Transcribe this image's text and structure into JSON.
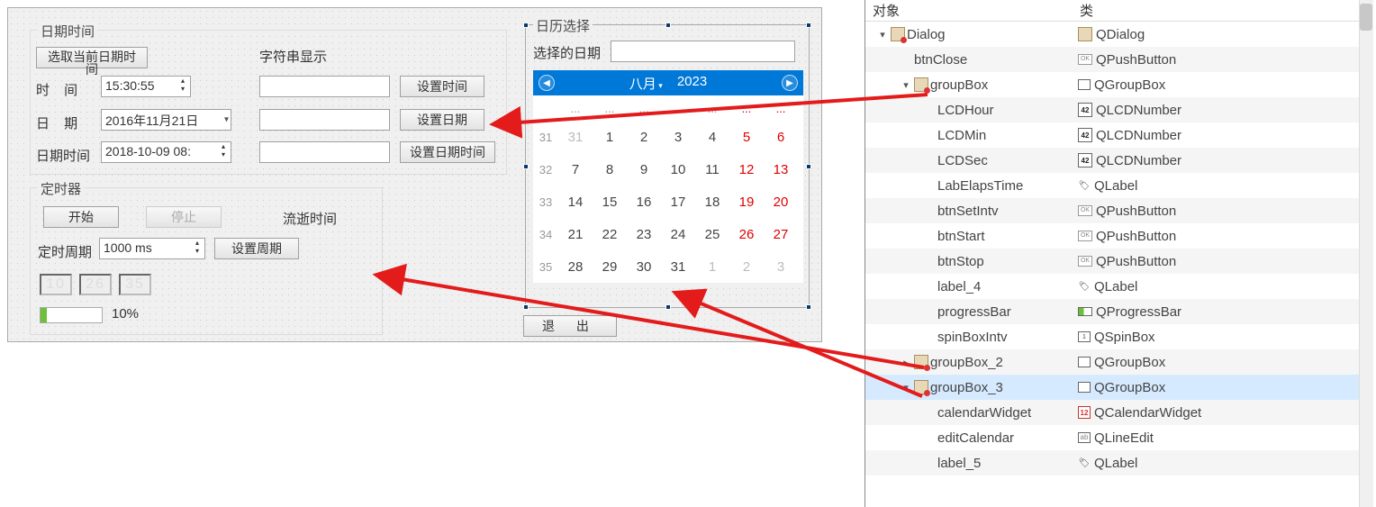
{
  "gb_datetime": {
    "title": "日期时间",
    "btn_get_now": "选取当前日期时间",
    "string_display": "字符串显示",
    "lbl_time": "时 间",
    "time_value": "15:30:55",
    "btn_set_time": "设置时间",
    "lbl_date": "日 期",
    "date_value": "2016年11月21日",
    "btn_set_date": "设置日期",
    "lbl_dt": "日期时间",
    "dt_value": "2018-10-09 08:",
    "btn_set_dt": "设置日期时间"
  },
  "gb_timer": {
    "title": "定时器",
    "btn_start": "开始",
    "btn_stop": "停止",
    "lbl_elapsed": "流逝时间",
    "lbl_period": "定时周期",
    "period_value": "1000 ms",
    "btn_set_period": "设置周期",
    "lcd": [
      "10",
      "26",
      "35"
    ],
    "progress_percent": "10%",
    "progress_value": 10
  },
  "gb_cal": {
    "title": "日历选择",
    "lbl_selected": "选择的日期",
    "selected_value": "",
    "month": "八月",
    "year": "2023",
    "dow": [
      "...",
      "...",
      "...",
      "...",
      "...",
      "...",
      "..."
    ],
    "weeks": [
      {
        "wk": "31",
        "days": [
          {
            "n": "31",
            "c": "gray"
          },
          {
            "n": "1"
          },
          {
            "n": "2"
          },
          {
            "n": "3"
          },
          {
            "n": "4"
          },
          {
            "n": "5",
            "c": "red"
          },
          {
            "n": "6",
            "c": "red"
          }
        ]
      },
      {
        "wk": "32",
        "days": [
          {
            "n": "7"
          },
          {
            "n": "8"
          },
          {
            "n": "9"
          },
          {
            "n": "10"
          },
          {
            "n": "11"
          },
          {
            "n": "12",
            "c": "red"
          },
          {
            "n": "13",
            "c": "red"
          }
        ]
      },
      {
        "wk": "33",
        "days": [
          {
            "n": "14"
          },
          {
            "n": "15"
          },
          {
            "n": "16"
          },
          {
            "n": "17"
          },
          {
            "n": "18"
          },
          {
            "n": "19",
            "c": "red"
          },
          {
            "n": "20",
            "c": "red"
          }
        ]
      },
      {
        "wk": "34",
        "days": [
          {
            "n": "21"
          },
          {
            "n": "22"
          },
          {
            "n": "23"
          },
          {
            "n": "24"
          },
          {
            "n": "25"
          },
          {
            "n": "26",
            "c": "red"
          },
          {
            "n": "27",
            "c": "red"
          }
        ]
      },
      {
        "wk": "35",
        "days": [
          {
            "n": "28"
          },
          {
            "n": "29"
          },
          {
            "n": "30"
          },
          {
            "n": "31"
          },
          {
            "n": "1",
            "c": "gray"
          },
          {
            "n": "2",
            "c": "gray"
          },
          {
            "n": "3",
            "c": "gray"
          }
        ]
      }
    ]
  },
  "btn_exit": "退 出",
  "inspector": {
    "header_obj": "对象",
    "header_class": "类",
    "rows": [
      {
        "indent": 0,
        "tw": "▾",
        "objicon": "formred",
        "obj": "Dialog",
        "clsicon": "form",
        "cls": "QDialog"
      },
      {
        "indent": 1,
        "tw": "",
        "objicon": "",
        "obj": "btnClose",
        "clsicon": "btn-ic",
        "cls": "QPushButton",
        "alt": true
      },
      {
        "indent": 1,
        "tw": "▾",
        "objicon": "formred",
        "obj": "groupBox",
        "clsicon": "grp",
        "cls": "QGroupBox"
      },
      {
        "indent": 2,
        "tw": "",
        "objicon": "",
        "obj": "LCDHour",
        "clsicon": "lcd",
        "cls": "QLCDNumber",
        "alt": true
      },
      {
        "indent": 2,
        "tw": "",
        "objicon": "",
        "obj": "LCDMin",
        "clsicon": "lcd",
        "cls": "QLCDNumber"
      },
      {
        "indent": 2,
        "tw": "",
        "objicon": "",
        "obj": "LCDSec",
        "clsicon": "lcd",
        "cls": "QLCDNumber",
        "alt": true
      },
      {
        "indent": 2,
        "tw": "",
        "objicon": "",
        "obj": "LabElapsTime",
        "clsicon": "lbl",
        "cls": "QLabel"
      },
      {
        "indent": 2,
        "tw": "",
        "objicon": "",
        "obj": "btnSetIntv",
        "clsicon": "btn-ic",
        "cls": "QPushButton",
        "alt": true
      },
      {
        "indent": 2,
        "tw": "",
        "objicon": "",
        "obj": "btnStart",
        "clsicon": "btn-ic",
        "cls": "QPushButton"
      },
      {
        "indent": 2,
        "tw": "",
        "objicon": "",
        "obj": "btnStop",
        "clsicon": "btn-ic",
        "cls": "QPushButton",
        "alt": true
      },
      {
        "indent": 2,
        "tw": "",
        "objicon": "",
        "obj": "label_4",
        "clsicon": "lbl",
        "cls": "QLabel"
      },
      {
        "indent": 2,
        "tw": "",
        "objicon": "",
        "obj": "progressBar",
        "clsicon": "prog",
        "cls": "QProgressBar",
        "alt": true
      },
      {
        "indent": 2,
        "tw": "",
        "objicon": "",
        "obj": "spinBoxIntv",
        "clsicon": "spin",
        "cls": "QSpinBox"
      },
      {
        "indent": 1,
        "tw": "▸",
        "objicon": "formred",
        "obj": "groupBox_2",
        "clsicon": "grp",
        "cls": "QGroupBox",
        "alt": true
      },
      {
        "indent": 1,
        "tw": "▾",
        "objicon": "formred",
        "obj": "groupBox_3",
        "clsicon": "grp",
        "cls": "QGroupBox",
        "sel": true
      },
      {
        "indent": 2,
        "tw": "",
        "objicon": "",
        "obj": "calendarWidget",
        "clsicon": "cal",
        "cls": "QCalendarWidget",
        "alt": true
      },
      {
        "indent": 2,
        "tw": "",
        "objicon": "",
        "obj": "editCalendar",
        "clsicon": "line",
        "cls": "QLineEdit"
      },
      {
        "indent": 2,
        "tw": "",
        "objicon": "",
        "obj": "label_5",
        "clsicon": "lbl",
        "cls": "QLabel",
        "alt": true
      }
    ]
  }
}
